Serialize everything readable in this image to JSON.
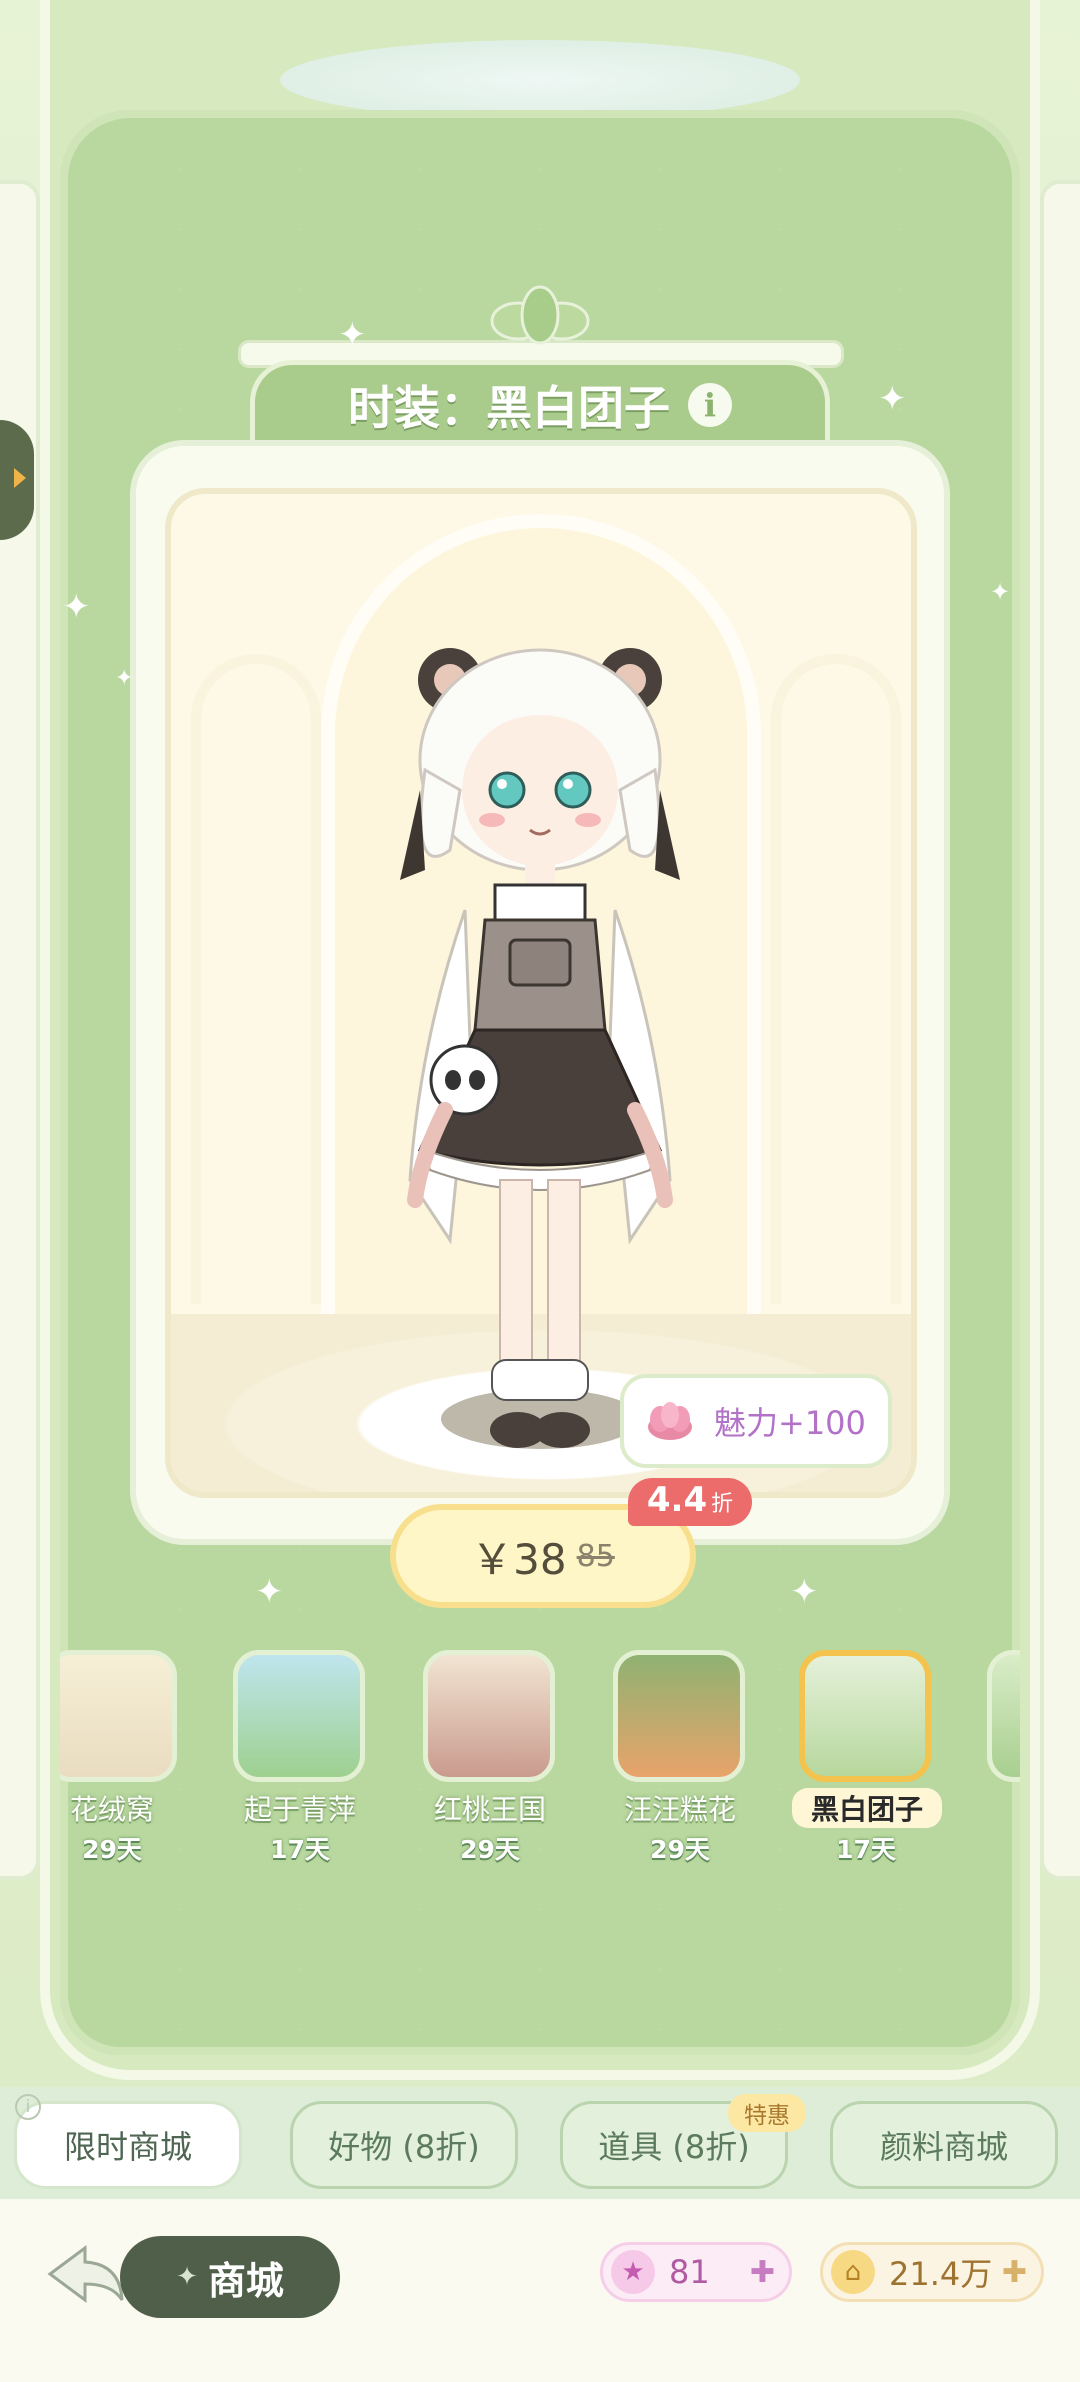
{
  "outfit": {
    "title": "时装：黑白团子",
    "charm": "魅力+100",
    "price_current": "￥38",
    "price_original": "85",
    "discount": "4.4",
    "discount_unit": "折"
  },
  "carousel": [
    {
      "name": "花绒窝",
      "days": "29天"
    },
    {
      "name": "起于青萍",
      "days": "17天"
    },
    {
      "name": "红桃王国",
      "days": "29天"
    },
    {
      "name": "汪汪糕花",
      "days": "29天"
    },
    {
      "name": "黑白团子",
      "days": "17天",
      "selected": true
    }
  ],
  "tabs": [
    {
      "label": "限时商城",
      "active": true
    },
    {
      "label": "好物 (8折)"
    },
    {
      "label": "道具 (8折)",
      "badge": "特惠"
    },
    {
      "label": "颜料商城"
    }
  ],
  "tab_info_icon": "i",
  "bottom": {
    "shop_label": "商城",
    "stars": "81",
    "coins": "21.4万"
  },
  "colors": {
    "theme_green": "#b9d89f",
    "discount_red": "#ec6b6b",
    "charm_purple": "#b272c7",
    "selected_gold": "#f3c34d"
  },
  "icons": {
    "info": "info-icon",
    "charm": "flower-icon",
    "back": "back-arrow-icon",
    "star": "star-icon",
    "coin": "coin-icon",
    "plus": "plus-icon"
  }
}
